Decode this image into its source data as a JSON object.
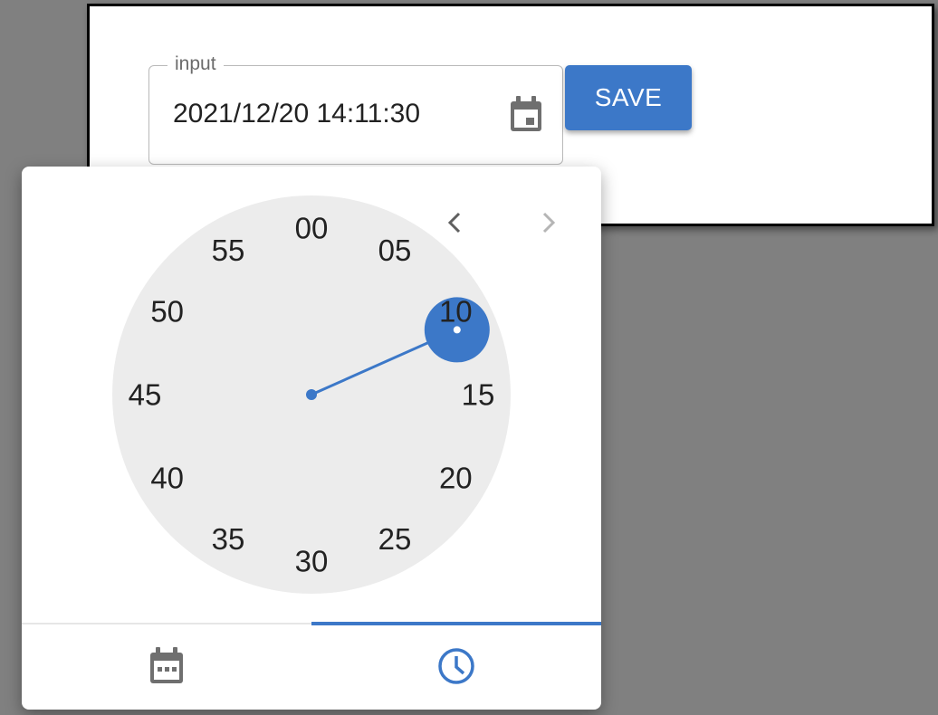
{
  "form": {
    "field_label": "input",
    "field_value": "2021/12/20 14:11:30",
    "save_label": "SAVE"
  },
  "clock": {
    "mode": "minutes",
    "selected_minute": 11,
    "numbers": [
      "00",
      "05",
      "10",
      "15",
      "20",
      "25",
      "30",
      "35",
      "40",
      "45",
      "50",
      "55"
    ],
    "accent_color": "#3c78c8",
    "face_color": "#ececec"
  },
  "picker": {
    "active_tab": "time",
    "tabs": [
      {
        "name": "date",
        "icon": "calendar-icon"
      },
      {
        "name": "time",
        "icon": "clock-icon"
      }
    ],
    "nav": {
      "prev_icon": "chevron-left-icon",
      "next_icon": "chevron-right-icon"
    }
  }
}
